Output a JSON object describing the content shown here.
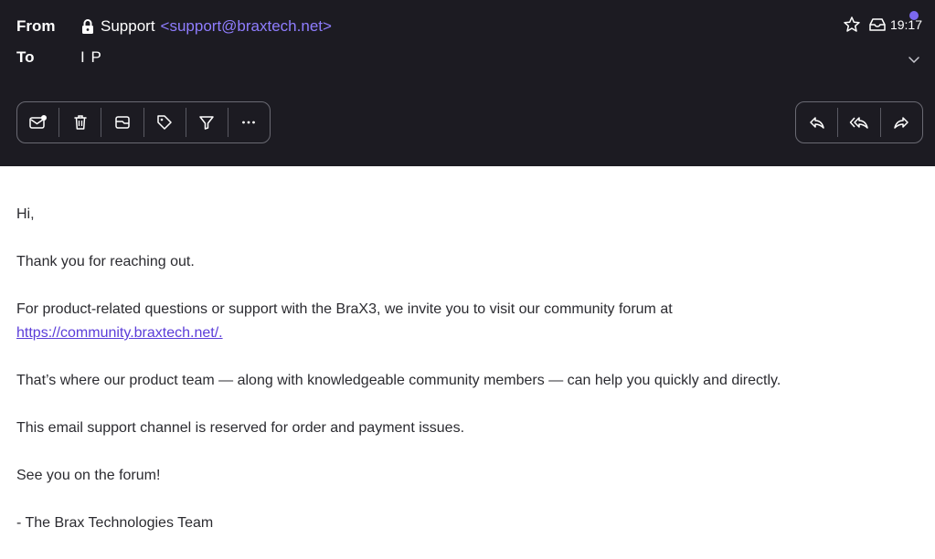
{
  "header": {
    "from_label": "From",
    "to_label": "To",
    "sender_name": "Support",
    "sender_email": "<support@braxtech.net>",
    "recipient": "I P",
    "time": "19:17",
    "colors": {
      "background": "#1c1b22",
      "email_link": "#8f7dff",
      "accent_dot": "#7b68ee"
    }
  },
  "toolbar_left": [
    {
      "icon": "mark-unread-icon"
    },
    {
      "icon": "trash-icon"
    },
    {
      "icon": "move-to-folder-icon"
    },
    {
      "icon": "label-icon"
    },
    {
      "icon": "filter-icon"
    },
    {
      "icon": "more-icon"
    }
  ],
  "toolbar_right": [
    {
      "icon": "reply-icon"
    },
    {
      "icon": "reply-all-icon"
    },
    {
      "icon": "forward-icon"
    }
  ],
  "body": {
    "greeting": "Hi,",
    "p1": "Thank you for reaching out.",
    "p2": "For product-related questions or support with the BraX3, we invite you to visit our community forum at",
    "link": "https://community.braxtech.net/.",
    "p3": "That’s where our product team — along with knowledgeable community members — can help you quickly and directly.",
    "p4": "This email support channel is reserved for order and payment issues.",
    "closing": "See you on the forum!",
    "signature": "- The Brax Technologies Team"
  }
}
